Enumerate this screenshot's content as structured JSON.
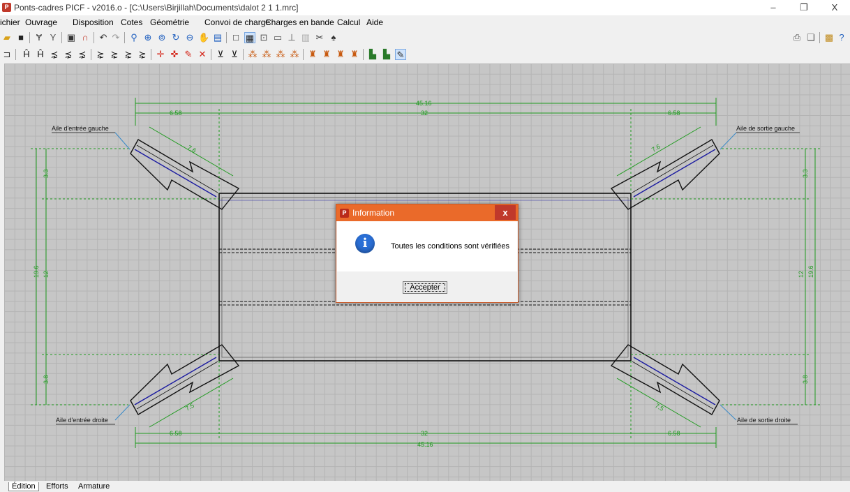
{
  "window": {
    "title": "Ponts-cadres PICF - v2016.o - [C:\\Users\\Birjillah\\Documents\\dalot 2 1 1.mrc]",
    "minimize": "–",
    "maximize": "❐",
    "close": "X"
  },
  "menu": [
    "ichier",
    "Ouvrage",
    "Disposition",
    "Cotes",
    "Géométrie",
    "Convoi de charge",
    "Charges en bande",
    "Calcul",
    "Aide"
  ],
  "drawing": {
    "dims": {
      "top_total": "45.16",
      "top_inner": "32",
      "top_left": "6.58",
      "top_right": "6.58",
      "bottom_total": "45.16",
      "bottom_inner": "32",
      "bottom_left": "6.58",
      "bottom_right": "6.58",
      "left_total": "19.6",
      "left_mid": "12",
      "left_top": "3.3",
      "left_bottom": "3.8",
      "right_total": "19.6",
      "right_mid": "12",
      "right_top": "3.3",
      "right_bottom": "3.8",
      "wing_tl": "7.6",
      "wing_tr": "7.6",
      "wing_bl": "7.5",
      "wing_br": "7.5"
    },
    "labels": {
      "wing_tl": "Aile d'entrée gauche",
      "wing_tr": "Aile de sortie gauche",
      "wing_bl": "Aile d'entrée droite",
      "wing_br": "Aile de sortie droite"
    }
  },
  "dialog": {
    "title": "Information",
    "close": "x",
    "message": "Toutes les conditions sont vérifiées",
    "info_glyph": "i",
    "button": "Accepter"
  },
  "tabs": [
    "Édition",
    "Efforts",
    "Armature"
  ],
  "colors": {
    "dimension": "#1e9a1e",
    "structure": "#111111",
    "wing_axis": "#1a1aa0",
    "dialog_title": "#ea6a2a",
    "canvas": "#c6c6c6"
  }
}
